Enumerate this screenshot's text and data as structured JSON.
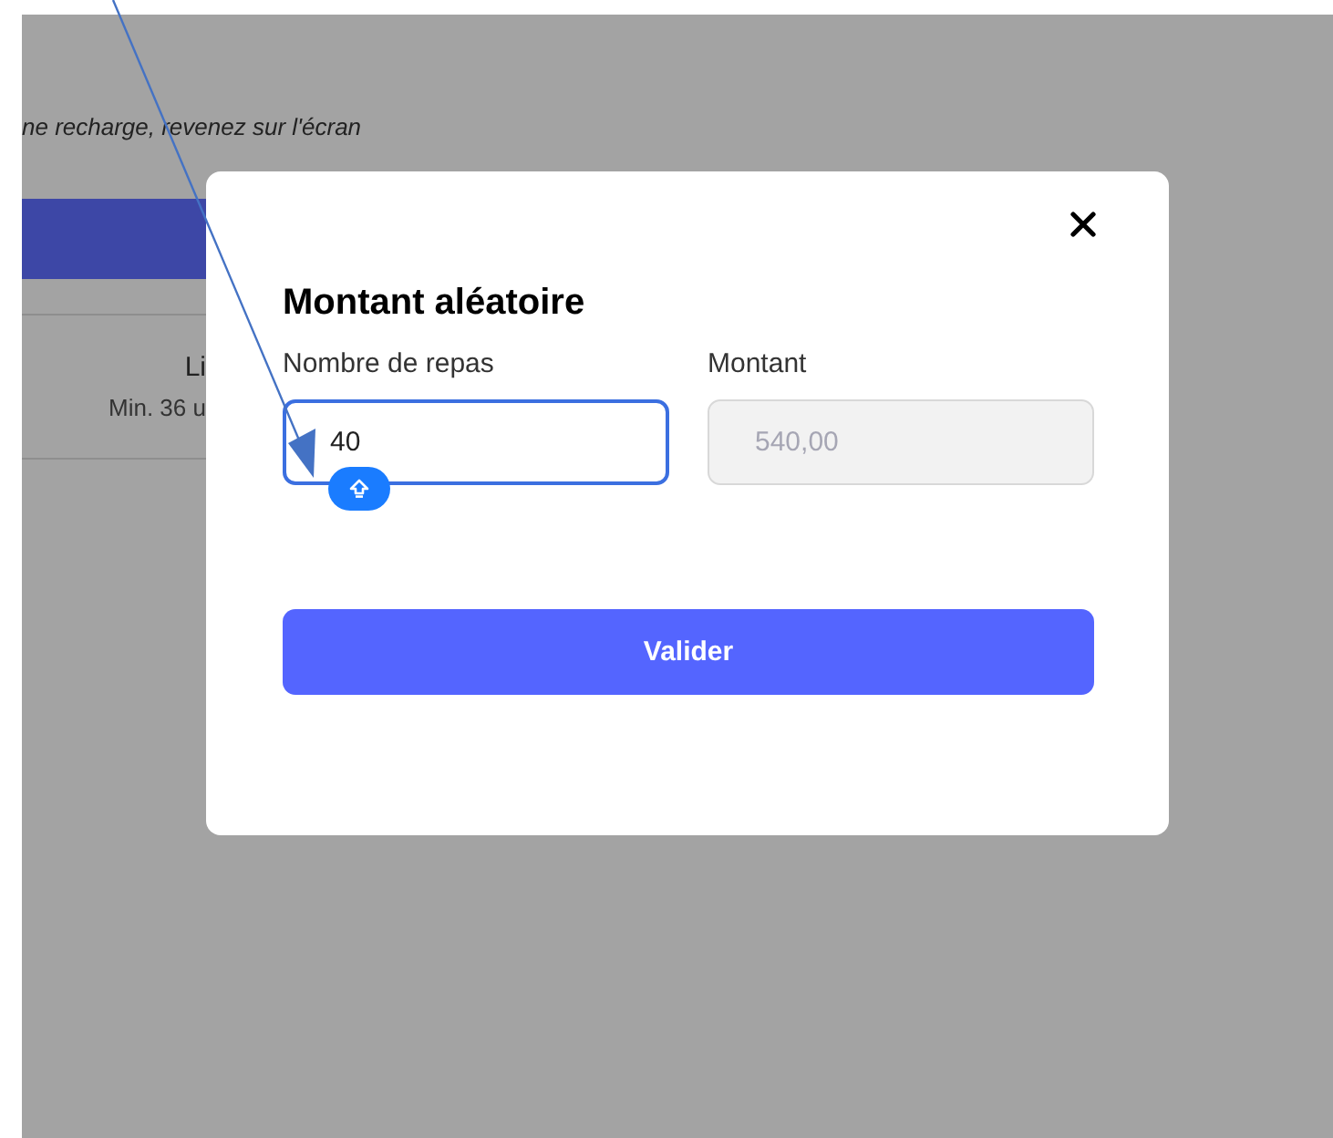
{
  "background_page": {
    "notice": "ne recharge, revenez sur l'écran",
    "option": {
      "title": "Li",
      "subtitle": "Min. 36 u"
    }
  },
  "dialog": {
    "title": "Montant aléatoire",
    "fields": [
      {
        "label": "Nombre de repas",
        "value": "40",
        "focused": true,
        "disabled": false,
        "caps_lock": true
      },
      {
        "label": "Montant",
        "value": "540,00",
        "focused": false,
        "disabled": true,
        "caps_lock": false
      }
    ],
    "button": "Valider"
  }
}
